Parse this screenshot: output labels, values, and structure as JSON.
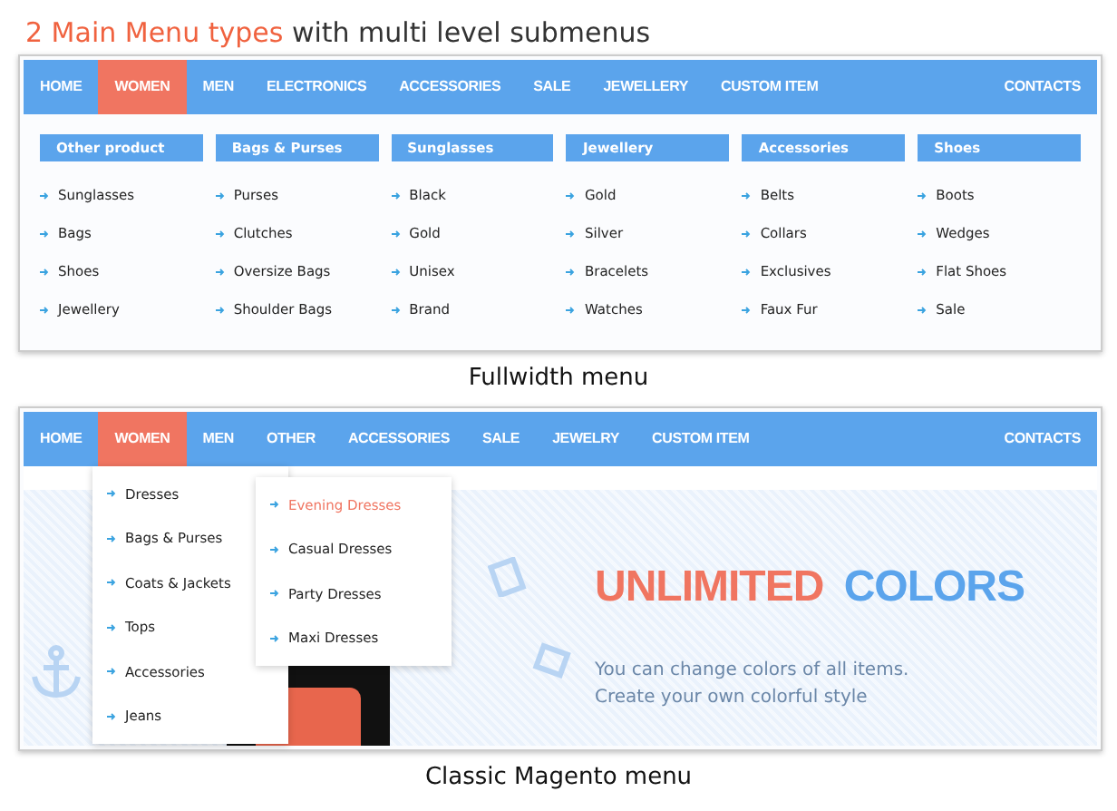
{
  "headline": {
    "accent": "2 Main Menu types",
    "rest": "with multi level submenus"
  },
  "fullwidth_demo": {
    "nav": {
      "items": [
        {
          "label": "HOME",
          "selected": false
        },
        {
          "label": "WOMEN",
          "selected": true
        },
        {
          "label": "MEN",
          "selected": false
        },
        {
          "label": "ELECTRONICS",
          "selected": false
        },
        {
          "label": "ACCESSORIES",
          "selected": false
        },
        {
          "label": "SALE",
          "selected": false
        },
        {
          "label": "JEWELLERY",
          "selected": false
        },
        {
          "label": "CUSTOM ITEM",
          "selected": false
        }
      ],
      "right_item": "CONTACTS"
    },
    "columns": [
      {
        "title": "Other product",
        "items": [
          "Sunglasses",
          "Bags",
          "Shoes",
          "Jewellery"
        ]
      },
      {
        "title": "Bags & Purses",
        "items": [
          "Purses",
          "Clutches",
          "Oversize Bags",
          "Shoulder Bags"
        ]
      },
      {
        "title": "Sunglasses",
        "items": [
          "Black",
          "Gold",
          "Unisex",
          "Brand"
        ]
      },
      {
        "title": "Jewellery",
        "items": [
          "Gold",
          "Silver",
          "Bracelets",
          "Watches"
        ]
      },
      {
        "title": "Accessories",
        "items": [
          "Belts",
          "Collars",
          "Exclusives",
          "Faux Fur"
        ]
      },
      {
        "title": "Shoes",
        "items": [
          "Boots",
          "Wedges",
          "Flat Shoes",
          "Sale"
        ]
      }
    ],
    "caption": "Fullwidth menu"
  },
  "classic_demo": {
    "nav": {
      "items": [
        {
          "label": "HOME",
          "selected": false
        },
        {
          "label": "WOMEN",
          "selected": true
        },
        {
          "label": "MEN",
          "selected": false
        },
        {
          "label": "OTHER",
          "selected": false
        },
        {
          "label": "ACCESSORIES",
          "selected": false
        },
        {
          "label": "SALE",
          "selected": false
        },
        {
          "label": "JEWELRY",
          "selected": false
        },
        {
          "label": "CUSTOM ITEM",
          "selected": false
        }
      ],
      "right_item": "CONTACTS"
    },
    "dropdown": [
      "Dresses",
      "Bags & Purses",
      "Coats & Jackets",
      "Tops",
      "Accessories",
      "Jeans"
    ],
    "submenu": [
      {
        "label": "Evening Dresses",
        "selected": true
      },
      {
        "label": "Casual Dresses",
        "selected": false
      },
      {
        "label": "Party Dresses",
        "selected": false
      },
      {
        "label": "Maxi Dresses",
        "selected": false
      }
    ],
    "banner": {
      "title_accent": "UNLIMITED",
      "title_rest": "COLORS",
      "text": "You can change colors of all items. Create your own colorful style"
    },
    "caption": "Classic Magento menu"
  }
}
